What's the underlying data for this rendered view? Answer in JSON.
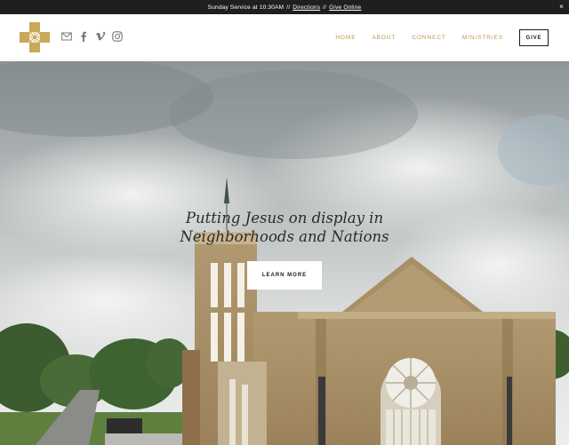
{
  "announcement": {
    "text": "Sunday Service at 10:30AM",
    "separator": "//",
    "directions_link": "Directions",
    "give_link": "Give Online",
    "close": "×"
  },
  "header": {
    "social": [
      "email-icon",
      "facebook-icon",
      "vimeo-icon",
      "instagram-icon"
    ],
    "nav": [
      {
        "label": "HOME"
      },
      {
        "label": "ABOUT"
      },
      {
        "label": "CONNECT"
      },
      {
        "label": "MINISTRIES"
      }
    ],
    "give_button": "GIVE"
  },
  "hero": {
    "headline_line1": "Putting Jesus on display in",
    "headline_line2": "Neighborhoods and Nations",
    "cta": "LEARN MORE"
  },
  "colors": {
    "accent_gold": "#b8974a",
    "announce_bg": "#1f1f1f",
    "text_dark": "#1a1a1a"
  }
}
